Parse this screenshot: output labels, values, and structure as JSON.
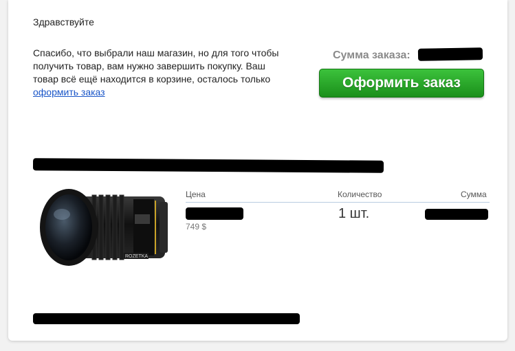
{
  "email": {
    "greeting": "Здравствуйте",
    "message_text": "Спасибо, что выбрали наш магазин, но для того чтобы получить товар, вам нужно завершить покупку. Ваш товар всё ещё находится в корзине, осталось только ",
    "message_link": "оформить заказ",
    "order_total_label": "Сумма заказа:",
    "checkout_button": "Оформить заказ"
  },
  "table": {
    "headers": {
      "price": "Цена",
      "quantity": "Количество",
      "sum": "Сумма"
    },
    "row": {
      "price_usd": "749 $",
      "quantity": "1 шт."
    }
  },
  "product_image": {
    "icon": "camera-lens-image",
    "watermark": "ROZETKA"
  },
  "colors": {
    "link": "#1a56c8",
    "button_green": "#28a828",
    "divider": "#b9cbe0"
  }
}
